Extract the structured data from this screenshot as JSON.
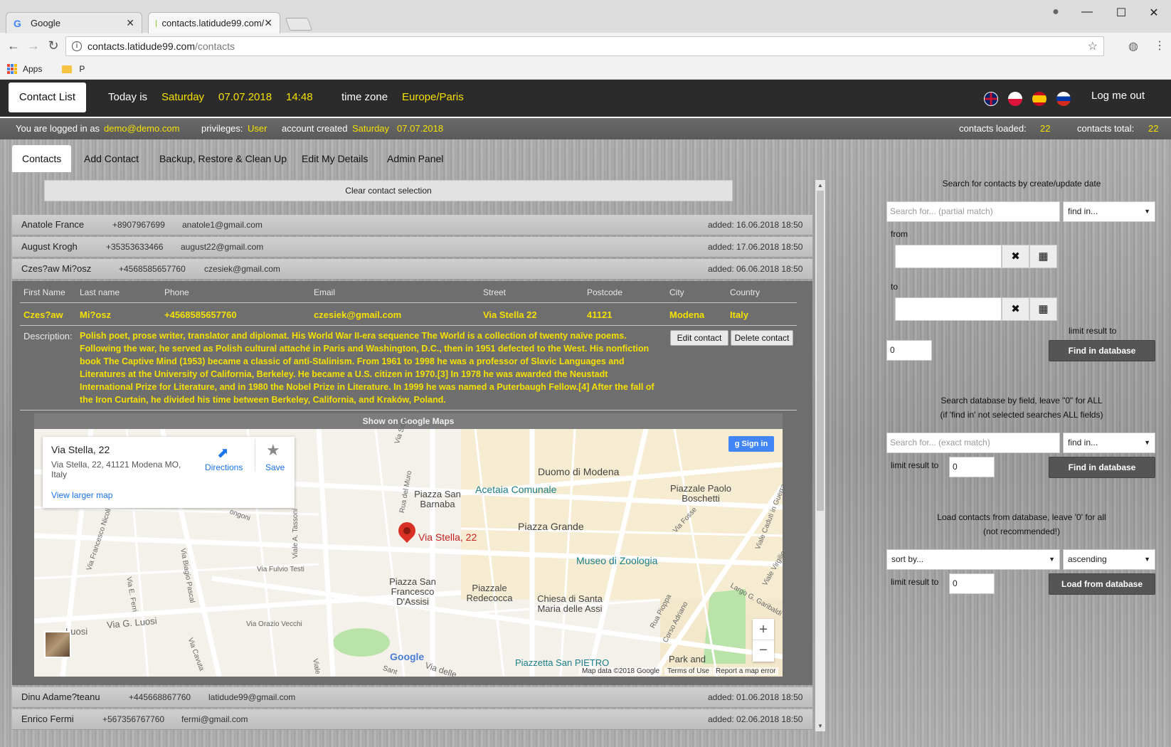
{
  "browser": {
    "tabs": [
      {
        "label": "Google",
        "favicon": "google-icon"
      },
      {
        "label": "contacts.latidude99.com/",
        "favicon": "leaf-icon"
      }
    ],
    "url_host": "contacts.latidude99.com",
    "url_path": "/contacts",
    "bookmarks": [
      {
        "label": "Apps"
      },
      {
        "label": "P"
      }
    ]
  },
  "header": {
    "logo": "Contact List",
    "today_label": "Today is",
    "day": "Saturday",
    "date": "07.07.2018",
    "time": "14:48",
    "tz_label": "time zone",
    "tz": "Europe/Paris",
    "logout": "Log me out",
    "flags": [
      "uk-flag-icon",
      "poland-flag-icon",
      "spain-flag-icon",
      "russia-flag-icon"
    ]
  },
  "infobar": {
    "logged_label": "You are logged in as",
    "email": "demo@demo.com",
    "priv_label": "privileges:",
    "priv": "User",
    "created_label": "account created",
    "created_day": "Saturday",
    "created_date": "07.07.2018",
    "loaded_label": "contacts loaded:",
    "loaded": "22",
    "total_label": "contacts total:",
    "total": "22"
  },
  "tabs": [
    "Contacts",
    "Add Contact",
    "Backup, Restore & Clean Up",
    "Edit My Details",
    "Admin Panel"
  ],
  "list": {
    "clear_label": "Clear contact selection",
    "rows_top": [
      {
        "name": "Anatole France",
        "phone": "+8907967699",
        "email": "anatole1@gmail.com",
        "added": "added: 16.06.2018 18:50"
      },
      {
        "name": "August Krogh",
        "phone": "+35353633466",
        "email": "august22@gmail.com",
        "added": "added: 17.06.2018 18:50"
      },
      {
        "name": "Czes?aw Mi?osz",
        "phone": "+4568585657760",
        "email": "czesiek@gmail.com",
        "added": "added: 06.06.2018 18:50"
      }
    ],
    "rows_bottom": [
      {
        "name": "Dinu Adame?teanu",
        "phone": "+445668867760",
        "email": "latidude99@gmail.com",
        "added": "added: 01.06.2018 18:50"
      },
      {
        "name": "Enrico Fermi",
        "phone": "+567356767760",
        "email": "fermi@gmail.com",
        "added": "added: 02.06.2018 18:50"
      }
    ]
  },
  "detail": {
    "headers": [
      "First Name",
      "Last name",
      "Phone",
      "Email",
      "Street",
      "Postcode",
      "City",
      "Country"
    ],
    "values": [
      "Czes?aw",
      "Mi?osz",
      "+4568585657760",
      "czesiek@gmail.com",
      "Via Stella 22",
      "41121",
      "Modena",
      "Italy"
    ],
    "desc_label": "Description:",
    "description": "Polish poet, prose writer, translator and diplomat. His World War II-era sequence The World is a collection of twenty naïve poems. Following the war, he served as Polish cultural attaché in Paris and Washington, D.C., then in 1951 defected to the West. His nonfiction book The Captive Mind (1953) became a classic of anti-Stalinism. From 1961 to 1998 he was a professor of Slavic Languages and Literatures at the University of California, Berkeley. He became a U.S. citizen in 1970.[3] In 1978 he was awarded the Neustadt International Prize for Literature, and in 1980 the Nobel Prize in Literature. In 1999 he was named a Puterbaugh Fellow.[4] After the fall of the Iron Curtain, he divided his time between Berkeley, California, and Kraków, Poland.",
    "edit": "Edit contact",
    "delete": "Delete contact",
    "show_map": "Show on Google Maps"
  },
  "map": {
    "card_title": "Via Stella, 22",
    "card_addr1": "Via Stella, 22, 41121 Modena MO,",
    "card_addr2": "Italy",
    "card_link": "View larger map",
    "directions": "Directions",
    "save": "Save",
    "signin": "Sign in",
    "pin_label": "Via Stella, 22",
    "places": [
      "Duomo di Modena",
      "Acetaia Comunale",
      "Piazza San Barnaba",
      "Piazza Grande",
      "Piazzale Paolo Boschetti",
      "Museo di Zoologia",
      "Piazza San Francesco D'Assisi",
      "Piazzale Redecocca",
      "Chiesa di Santa Maria delle Assi",
      "Piazzetta San PIETRO",
      "Park and"
    ],
    "streets": [
      "Via Fulvio Testi",
      "Viale A. Tassoni",
      "Via G. Luosi",
      "Via Orazio Vecchi",
      "Via Francesco Nicoli",
      "Via E. Ferri",
      "Via Biagio Pascal",
      "Via Cavuta",
      "Viale Caduti in Guerra",
      "Viale Virgilio",
      "Largo G. Garibaldi",
      "Rua Pioppa",
      "Corso Adriano",
      "Via Fosse",
      "Rua del Muro",
      "Via Sant",
      "Viale",
      "Luosi",
      "ongoni",
      "Via delle",
      "Sant"
    ],
    "footer": [
      "Map data ©2018 Google",
      "Terms of Use",
      "Report a map error"
    ],
    "brand": "Google"
  },
  "right": {
    "date_title": "Search for contacts by create/update date",
    "partial_ph": "Search for... (partial match)",
    "find_in": "find in...",
    "from": "from",
    "to": "to",
    "limit_label": "limit result to",
    "limit_val": "0",
    "find_btn": "Find in database",
    "field_title1": "Search database by field, leave \"0\" for ALL",
    "field_title2": "(if 'find in' not selected searches ALL fields)",
    "exact_ph": "Search for... (exact match)",
    "load_title1": "Load contacts from database, leave '0' for all",
    "load_title2": "(not recommended!)",
    "sort_by": "sort by...",
    "order": "ascending",
    "load_btn": "Load from database"
  },
  "colors": {
    "accent_yellow": "#f5e000",
    "header_bg": "#2b2b2b",
    "button_dark": "#555555",
    "map_blue": "#4285f4",
    "pin_red": "#d93025"
  }
}
